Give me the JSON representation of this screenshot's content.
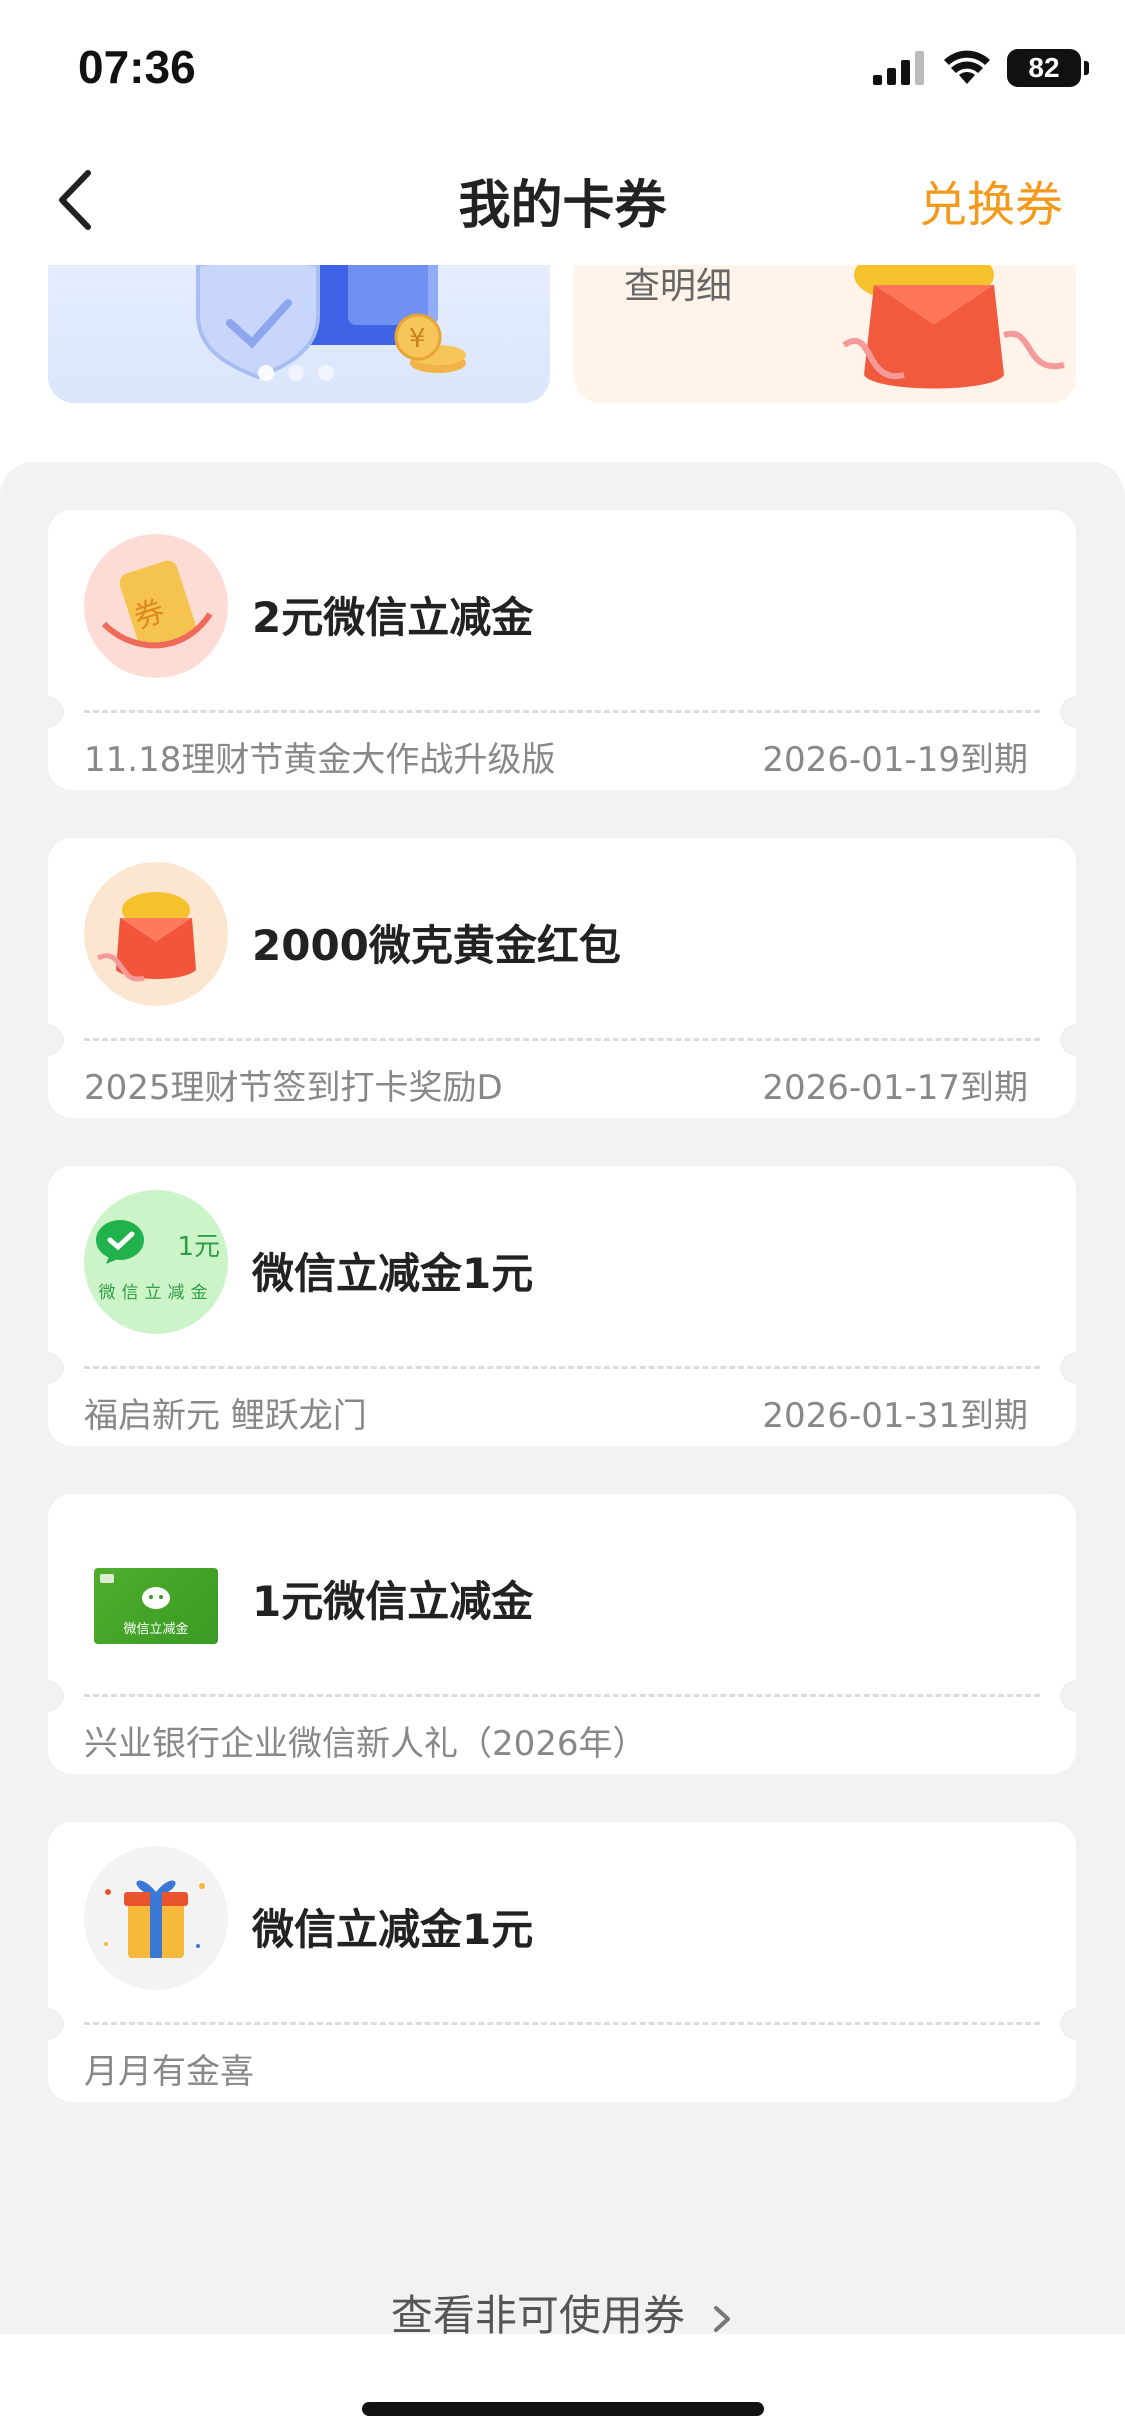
{
  "status_bar": {
    "time": "07:36",
    "battery": "82"
  },
  "nav": {
    "title": "我的卡券",
    "action": "兑换券"
  },
  "banners": {
    "right_text": "查明细"
  },
  "coupons": [
    {
      "title": "2元微信立减金",
      "source": "11.18理财节黄金大作战升级版",
      "expiry": "2026-01-19到期"
    },
    {
      "title": "2000微克黄金红包",
      "source": "2025理财节签到打卡奖励D",
      "expiry": "2026-01-17到期"
    },
    {
      "title": "微信立减金1元",
      "source": "福启新元 鲤跃龙门",
      "expiry": "2026-01-31到期",
      "thumb_amount": "1元",
      "thumb_label": "微信立减金"
    },
    {
      "title": "1元微信立减金",
      "source": "兴业银行企业微信新人礼（2026年）",
      "expiry": "",
      "thumb_label": "微信立减金"
    },
    {
      "title": "微信立减金1元",
      "source": "月月有金喜",
      "expiry": ""
    }
  ],
  "footer": {
    "view_more": "查看非可使用券"
  },
  "colors": {
    "accent": "#f39a1c",
    "page_bg": "#f2f2f2",
    "wechat_green": "#21b24d"
  }
}
